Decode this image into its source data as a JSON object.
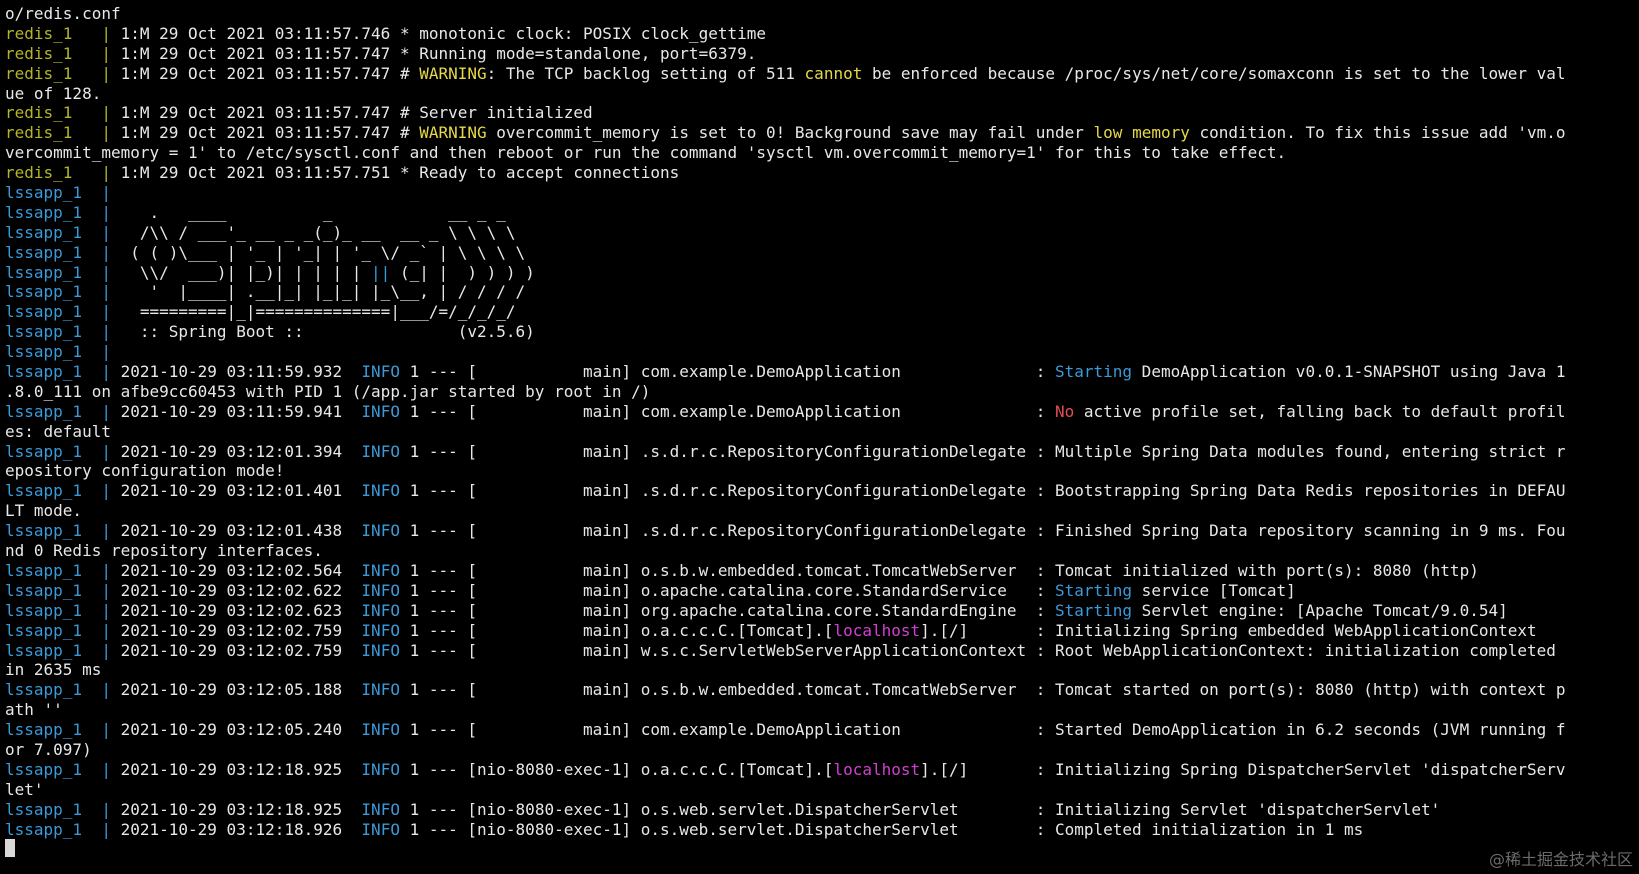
{
  "terminal": {
    "background": "#000000",
    "colors": {
      "default": "#e8e8e8",
      "redis": "#b5b528",
      "lssapp": "#3a9ad9",
      "info": "#3a9ad9",
      "starting": "#3a9ad9",
      "warning": "#e6d84a",
      "no": "#e05050",
      "localhost": "#d040d0"
    },
    "lines": [
      [
        {
          "t": "o/redis.conf"
        }
      ],
      [
        {
          "t": "redis_1   ",
          "c": "redis"
        },
        {
          "t": "| ",
          "c": "redis"
        },
        {
          "t": "1:M 29 Oct 2021 03:11:57.746 * monotonic clock: POSIX clock_gettime"
        }
      ],
      [
        {
          "t": "redis_1   ",
          "c": "redis"
        },
        {
          "t": "| ",
          "c": "redis"
        },
        {
          "t": "1:M 29 Oct 2021 03:11:57.747 * Running mode=standalone, port=6379."
        }
      ],
      [
        {
          "t": "redis_1   ",
          "c": "redis"
        },
        {
          "t": "| ",
          "c": "redis"
        },
        {
          "t": "1:M 29 Oct 2021 03:11:57.747 # "
        },
        {
          "t": "WARNING",
          "c": "warning"
        },
        {
          "t": ": The TCP backlog setting of 511 "
        },
        {
          "t": "cannot",
          "c": "warning"
        },
        {
          "t": " be enforced because /proc/sys/net/core/somaxconn is set to the lower val"
        }
      ],
      [
        {
          "t": "ue of 128."
        }
      ],
      [
        {
          "t": "redis_1   ",
          "c": "redis"
        },
        {
          "t": "| ",
          "c": "redis"
        },
        {
          "t": "1:M 29 Oct 2021 03:11:57.747 # Server initialized"
        }
      ],
      [
        {
          "t": "redis_1   ",
          "c": "redis"
        },
        {
          "t": "| ",
          "c": "redis"
        },
        {
          "t": "1:M 29 Oct 2021 03:11:57.747 # "
        },
        {
          "t": "WARNING",
          "c": "warning"
        },
        {
          "t": " overcommit_memory is set to 0! Background save may fail under "
        },
        {
          "t": "low memory",
          "c": "warning"
        },
        {
          "t": " condition. To fix this issue add 'vm.o"
        }
      ],
      [
        {
          "t": "vercommit_memory = 1' to /etc/sysctl.conf and then reboot or run the command 'sysctl vm.overcommit_memory=1' for this to take effect."
        }
      ],
      [
        {
          "t": "redis_1   ",
          "c": "redis"
        },
        {
          "t": "| ",
          "c": "redis"
        },
        {
          "t": "1:M 29 Oct 2021 03:11:57.751 * Ready to accept connections"
        }
      ],
      [
        {
          "t": "lssapp_1  ",
          "c": "lssapp"
        },
        {
          "t": "| ",
          "c": "lssapp"
        }
      ],
      [
        {
          "t": "lssapp_1  ",
          "c": "lssapp"
        },
        {
          "t": "| ",
          "c": "lssapp"
        },
        {
          "t": "   .   ____          _            __ _ _"
        }
      ],
      [
        {
          "t": "lssapp_1  ",
          "c": "lssapp"
        },
        {
          "t": "| ",
          "c": "lssapp"
        },
        {
          "t": "  /\\\\ / ___'_ __ _ _(_)_ __  __ _ \\ \\ \\ \\"
        }
      ],
      [
        {
          "t": "lssapp_1  ",
          "c": "lssapp"
        },
        {
          "t": "| ",
          "c": "lssapp"
        },
        {
          "t": " ( ( )\\___ | '_ | '_| | '_ \\/ _` | \\ \\ \\ \\"
        }
      ],
      [
        {
          "t": "lssapp_1  ",
          "c": "lssapp"
        },
        {
          "t": "| ",
          "c": "lssapp"
        },
        {
          "t": "  \\\\/  ___)| |_)| | | | | "
        },
        {
          "t": "||",
          "c": "lssapp"
        },
        {
          "t": " (_| |  ) ) ) )"
        }
      ],
      [
        {
          "t": "lssapp_1  ",
          "c": "lssapp"
        },
        {
          "t": "| ",
          "c": "lssapp"
        },
        {
          "t": "   '  |____| .__|_| |_|_| |_\\__, | / / / /"
        }
      ],
      [
        {
          "t": "lssapp_1  ",
          "c": "lssapp"
        },
        {
          "t": "| ",
          "c": "lssapp"
        },
        {
          "t": "  =========|_|==============|___/=/_/_/_/"
        }
      ],
      [
        {
          "t": "lssapp_1  ",
          "c": "lssapp"
        },
        {
          "t": "| ",
          "c": "lssapp"
        },
        {
          "t": "  :: Spring Boot ::                (v2.5.6)"
        }
      ],
      [
        {
          "t": "lssapp_1  ",
          "c": "lssapp"
        },
        {
          "t": "| ",
          "c": "lssapp"
        }
      ],
      [
        {
          "t": "lssapp_1  ",
          "c": "lssapp"
        },
        {
          "t": "| ",
          "c": "lssapp"
        },
        {
          "t": "2021-10-29 03:11:59.932  "
        },
        {
          "t": "INFO",
          "c": "info"
        },
        {
          "t": " 1 --- [           main] com.example.DemoApplication              : "
        },
        {
          "t": "Starting",
          "c": "starting"
        },
        {
          "t": " DemoApplication v0.0.1-SNAPSHOT using Java 1"
        }
      ],
      [
        {
          "t": ".8.0_111 on afbe9cc60453 with PID 1 (/app.jar started by root in /)"
        }
      ],
      [
        {
          "t": "lssapp_1  ",
          "c": "lssapp"
        },
        {
          "t": "| ",
          "c": "lssapp"
        },
        {
          "t": "2021-10-29 03:11:59.941  "
        },
        {
          "t": "INFO",
          "c": "info"
        },
        {
          "t": " 1 --- [           main] com.example.DemoApplication              : "
        },
        {
          "t": "No",
          "c": "no"
        },
        {
          "t": " active profile set, falling back to default profil"
        }
      ],
      [
        {
          "t": "es: default"
        }
      ],
      [
        {
          "t": "lssapp_1  ",
          "c": "lssapp"
        },
        {
          "t": "| ",
          "c": "lssapp"
        },
        {
          "t": "2021-10-29 03:12:01.394  "
        },
        {
          "t": "INFO",
          "c": "info"
        },
        {
          "t": " 1 --- [           main] .s.d.r.c.RepositoryConfigurationDelegate : Multiple Spring Data modules found, entering strict r"
        }
      ],
      [
        {
          "t": "epository configuration mode!"
        }
      ],
      [
        {
          "t": "lssapp_1  ",
          "c": "lssapp"
        },
        {
          "t": "| ",
          "c": "lssapp"
        },
        {
          "t": "2021-10-29 03:12:01.401  "
        },
        {
          "t": "INFO",
          "c": "info"
        },
        {
          "t": " 1 --- [           main] .s.d.r.c.RepositoryConfigurationDelegate : Bootstrapping Spring Data Redis repositories in DEFAU"
        }
      ],
      [
        {
          "t": "LT mode."
        }
      ],
      [
        {
          "t": "lssapp_1  ",
          "c": "lssapp"
        },
        {
          "t": "| ",
          "c": "lssapp"
        },
        {
          "t": "2021-10-29 03:12:01.438  "
        },
        {
          "t": "INFO",
          "c": "info"
        },
        {
          "t": " 1 --- [           main] .s.d.r.c.RepositoryConfigurationDelegate : Finished Spring Data repository scanning in 9 ms. Fou"
        }
      ],
      [
        {
          "t": "nd 0 Redis repository interfaces."
        }
      ],
      [
        {
          "t": "lssapp_1  ",
          "c": "lssapp"
        },
        {
          "t": "| ",
          "c": "lssapp"
        },
        {
          "t": "2021-10-29 03:12:02.564  "
        },
        {
          "t": "INFO",
          "c": "info"
        },
        {
          "t": " 1 --- [           main] o.s.b.w.embedded.tomcat.TomcatWebServer  : Tomcat initialized with port(s): 8080 (http)"
        }
      ],
      [
        {
          "t": "lssapp_1  ",
          "c": "lssapp"
        },
        {
          "t": "| ",
          "c": "lssapp"
        },
        {
          "t": "2021-10-29 03:12:02.622  "
        },
        {
          "t": "INFO",
          "c": "info"
        },
        {
          "t": " 1 --- [           main] o.apache.catalina.core.StandardService   : "
        },
        {
          "t": "Starting",
          "c": "starting"
        },
        {
          "t": " service [Tomcat]"
        }
      ],
      [
        {
          "t": "lssapp_1  ",
          "c": "lssapp"
        },
        {
          "t": "| ",
          "c": "lssapp"
        },
        {
          "t": "2021-10-29 03:12:02.623  "
        },
        {
          "t": "INFO",
          "c": "info"
        },
        {
          "t": " 1 --- [           main] org.apache.catalina.core.StandardEngine  : "
        },
        {
          "t": "Starting",
          "c": "starting"
        },
        {
          "t": " Servlet engine: [Apache Tomcat/9.0.54]"
        }
      ],
      [
        {
          "t": "lssapp_1  ",
          "c": "lssapp"
        },
        {
          "t": "| ",
          "c": "lssapp"
        },
        {
          "t": "2021-10-29 03:12:02.759  "
        },
        {
          "t": "INFO",
          "c": "info"
        },
        {
          "t": " 1 --- [           main] o.a.c.c.C.[Tomcat].["
        },
        {
          "t": "localhost",
          "c": "localhost"
        },
        {
          "t": "].[/]       : Initializing Spring embedded WebApplicationContext"
        }
      ],
      [
        {
          "t": "lssapp_1  ",
          "c": "lssapp"
        },
        {
          "t": "| ",
          "c": "lssapp"
        },
        {
          "t": "2021-10-29 03:12:02.759  "
        },
        {
          "t": "INFO",
          "c": "info"
        },
        {
          "t": " 1 --- [           main] w.s.c.ServletWebServerApplicationContext : Root WebApplicationContext: initialization completed"
        }
      ],
      [
        {
          "t": "in 2635 ms"
        }
      ],
      [
        {
          "t": "lssapp_1  ",
          "c": "lssapp"
        },
        {
          "t": "| ",
          "c": "lssapp"
        },
        {
          "t": "2021-10-29 03:12:05.188  "
        },
        {
          "t": "INFO",
          "c": "info"
        },
        {
          "t": " 1 --- [           main] o.s.b.w.embedded.tomcat.TomcatWebServer  : Tomcat started on port(s): 8080 (http) with context p"
        }
      ],
      [
        {
          "t": "ath ''"
        }
      ],
      [
        {
          "t": "lssapp_1  ",
          "c": "lssapp"
        },
        {
          "t": "| ",
          "c": "lssapp"
        },
        {
          "t": "2021-10-29 03:12:05.240  "
        },
        {
          "t": "INFO",
          "c": "info"
        },
        {
          "t": " 1 --- [           main] com.example.DemoApplication              : Started DemoApplication in 6.2 seconds (JVM running f"
        }
      ],
      [
        {
          "t": "or 7.097)"
        }
      ],
      [
        {
          "t": "lssapp_1  ",
          "c": "lssapp"
        },
        {
          "t": "| ",
          "c": "lssapp"
        },
        {
          "t": "2021-10-29 03:12:18.925  "
        },
        {
          "t": "INFO",
          "c": "info"
        },
        {
          "t": " 1 --- [nio-8080-exec-1] o.a.c.c.C.[Tomcat].["
        },
        {
          "t": "localhost",
          "c": "localhost"
        },
        {
          "t": "].[/]       : Initializing Spring DispatcherServlet 'dispatcherServ"
        }
      ],
      [
        {
          "t": "let'"
        }
      ],
      [
        {
          "t": "lssapp_1  ",
          "c": "lssapp"
        },
        {
          "t": "| ",
          "c": "lssapp"
        },
        {
          "t": "2021-10-29 03:12:18.925  "
        },
        {
          "t": "INFO",
          "c": "info"
        },
        {
          "t": " 1 --- [nio-8080-exec-1] o.s.web.servlet.DispatcherServlet        : Initializing Servlet 'dispatcherServlet'"
        }
      ],
      [
        {
          "t": "lssapp_1  ",
          "c": "lssapp"
        },
        {
          "t": "| ",
          "c": "lssapp"
        },
        {
          "t": "2021-10-29 03:12:18.926  "
        },
        {
          "t": "INFO",
          "c": "info"
        },
        {
          "t": " 1 --- [nio-8080-exec-1] o.s.web.servlet.DispatcherServlet        : Completed initialization in 1 ms"
        }
      ]
    ]
  },
  "watermark": "@稀土掘金技术社区"
}
